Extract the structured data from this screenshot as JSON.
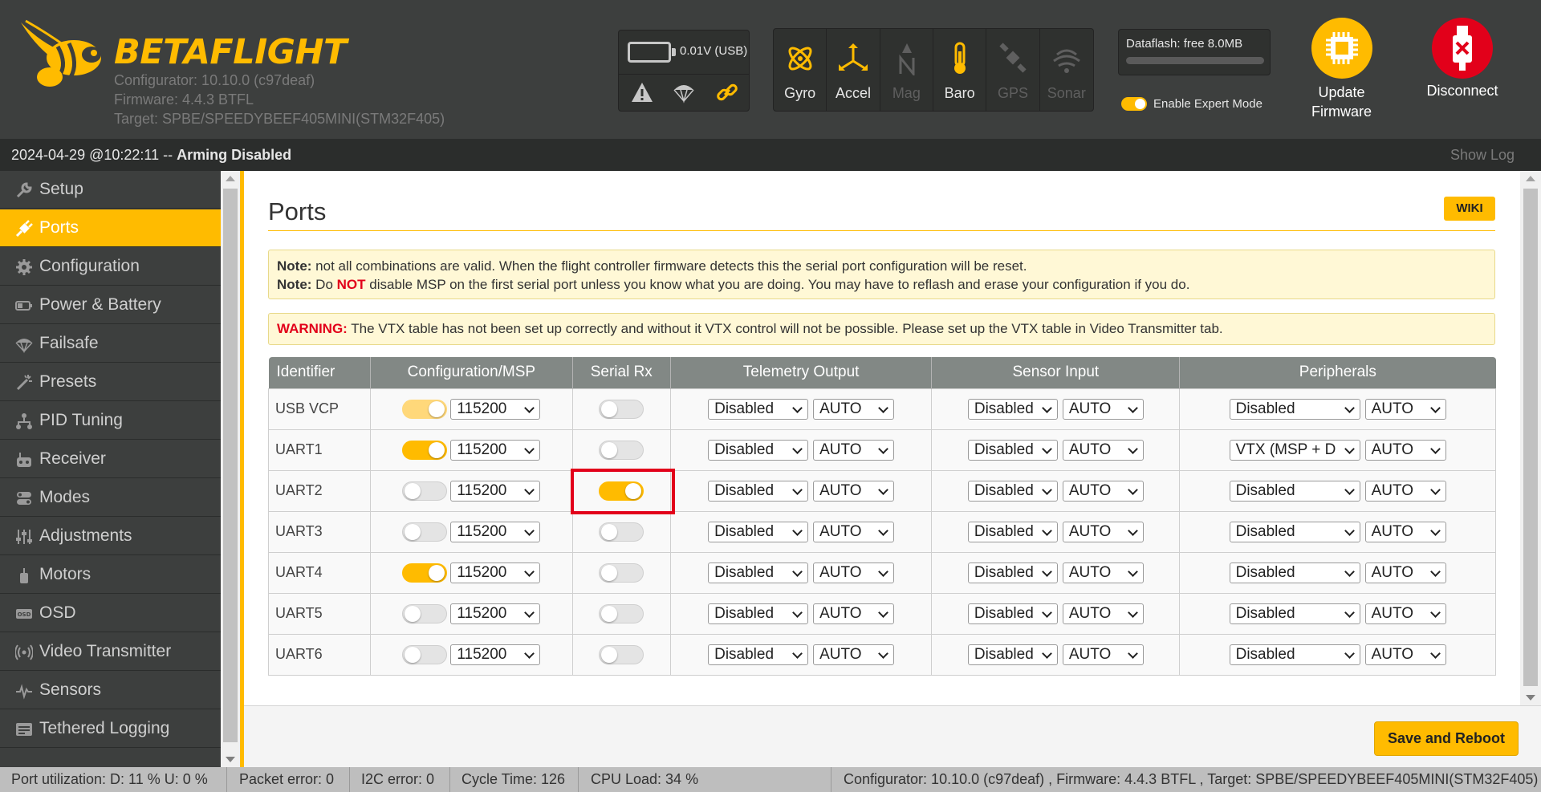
{
  "header": {
    "logo_text": "BETAFLIGHT",
    "configurator": "Configurator: 10.10.0 (c97deaf)",
    "firmware": "Firmware: 4.4.3 BTFL",
    "target": "Target: SPBE/SPEEDYBEEF405MINI(STM32F405)",
    "battery_voltage": "0.01V (USB)",
    "sensors": [
      {
        "label": "Gyro",
        "icon": "gyro-icon",
        "active": true
      },
      {
        "label": "Accel",
        "icon": "accel-icon",
        "active": true
      },
      {
        "label": "Mag",
        "icon": "mag-icon",
        "active": false
      },
      {
        "label": "Baro",
        "icon": "baro-icon",
        "active": true
      },
      {
        "label": "GPS",
        "icon": "gps-icon",
        "active": false
      },
      {
        "label": "Sonar",
        "icon": "sonar-icon",
        "active": false
      }
    ],
    "dataflash": "Dataflash: free 8.0MB",
    "expert_mode_label": "Enable Expert Mode",
    "update_firmware_label": "Update Firmware",
    "disconnect_label": "Disconnect"
  },
  "status_bar": {
    "timestamp": "2024-04-29 @10:22:11",
    "separator": " -- ",
    "arming": "Arming Disabled",
    "show_log": "Show Log"
  },
  "sidebar": {
    "active_index": 1,
    "items": [
      {
        "label": "Setup",
        "icon": "wrench-icon"
      },
      {
        "label": "Ports",
        "icon": "plug-icon"
      },
      {
        "label": "Configuration",
        "icon": "gear-icon"
      },
      {
        "label": "Power & Battery",
        "icon": "battery-icon"
      },
      {
        "label": "Failsafe",
        "icon": "parachute-icon"
      },
      {
        "label": "Presets",
        "icon": "wand-icon"
      },
      {
        "label": "PID Tuning",
        "icon": "pid-icon"
      },
      {
        "label": "Receiver",
        "icon": "receiver-icon"
      },
      {
        "label": "Modes",
        "icon": "modes-icon"
      },
      {
        "label": "Adjustments",
        "icon": "sliders-icon"
      },
      {
        "label": "Motors",
        "icon": "motor-icon"
      },
      {
        "label": "OSD",
        "icon": "osd-icon"
      },
      {
        "label": "Video Transmitter",
        "icon": "antenna-icon"
      },
      {
        "label": "Sensors",
        "icon": "pulse-icon"
      },
      {
        "label": "Tethered Logging",
        "icon": "log-icon"
      }
    ]
  },
  "main": {
    "title": "Ports",
    "wiki_label": "WIKI",
    "note1_label": "Note:",
    "note1_text": " not all combinations are valid. When the flight controller firmware detects this the serial port configuration will be reset.",
    "note2_label": "Note:",
    "note2_pre": " Do ",
    "note2_not": "NOT",
    "note2_post": " disable MSP on the first serial port unless you know what you are doing. You may have to reflash and erase your configuration if you do.",
    "warning_label": "WARNING:",
    "warning_text": " The VTX table has not been set up correctly and without it VTX control will not be possible. Please set up the VTX table in Video Transmitter tab.",
    "columns": [
      "Identifier",
      "Configuration/MSP",
      "Serial Rx",
      "Telemetry Output",
      "Sensor Input",
      "Peripherals"
    ],
    "rows": [
      {
        "id": "USB VCP",
        "msp": "disabled",
        "baud": "115200",
        "rx": false,
        "telemetry": "Disabled",
        "telemetry_baud": "AUTO",
        "sensor": "Disabled",
        "sensor_baud": "AUTO",
        "peripheral": "Disabled",
        "peripheral_baud": "AUTO"
      },
      {
        "id": "UART1",
        "msp": "on",
        "baud": "115200",
        "rx": false,
        "telemetry": "Disabled",
        "telemetry_baud": "AUTO",
        "sensor": "Disabled",
        "sensor_baud": "AUTO",
        "peripheral": "VTX (MSP + D",
        "peripheral_baud": "AUTO"
      },
      {
        "id": "UART2",
        "msp": "off",
        "baud": "115200",
        "rx": true,
        "telemetry": "Disabled",
        "telemetry_baud": "AUTO",
        "sensor": "Disabled",
        "sensor_baud": "AUTO",
        "peripheral": "Disabled",
        "peripheral_baud": "AUTO"
      },
      {
        "id": "UART3",
        "msp": "off",
        "baud": "115200",
        "rx": false,
        "telemetry": "Disabled",
        "telemetry_baud": "AUTO",
        "sensor": "Disabled",
        "sensor_baud": "AUTO",
        "peripheral": "Disabled",
        "peripheral_baud": "AUTO"
      },
      {
        "id": "UART4",
        "msp": "on",
        "baud": "115200",
        "rx": false,
        "telemetry": "Disabled",
        "telemetry_baud": "AUTO",
        "sensor": "Disabled",
        "sensor_baud": "AUTO",
        "peripheral": "Disabled",
        "peripheral_baud": "AUTO"
      },
      {
        "id": "UART5",
        "msp": "off",
        "baud": "115200",
        "rx": false,
        "telemetry": "Disabled",
        "telemetry_baud": "AUTO",
        "sensor": "Disabled",
        "sensor_baud": "AUTO",
        "peripheral": "Disabled",
        "peripheral_baud": "AUTO"
      },
      {
        "id": "UART6",
        "msp": "off",
        "baud": "115200",
        "rx": false,
        "telemetry": "Disabled",
        "telemetry_baud": "AUTO",
        "sensor": "Disabled",
        "sensor_baud": "AUTO",
        "peripheral": "Disabled",
        "peripheral_baud": "AUTO"
      }
    ],
    "save_reboot_label": "Save and Reboot"
  },
  "bottom_status": {
    "port_util": "Port utilization: D: 11 % U: 0 %",
    "packet_error": "Packet error: 0",
    "i2c_error": "I2C error: 0",
    "cycle_time": "Cycle Time: 126",
    "cpu_load": "CPU Load: 34 %",
    "version": "Configurator: 10.10.0 (c97deaf) , Firmware: 4.4.3 BTFL , Target: SPBE/SPEEDYBEEF405MINI(STM32F405)"
  },
  "colors": {
    "accent": "#ffbb00",
    "danger": "#e2001a",
    "header_bg": "#3d3f3e",
    "table_header": "#828885"
  }
}
